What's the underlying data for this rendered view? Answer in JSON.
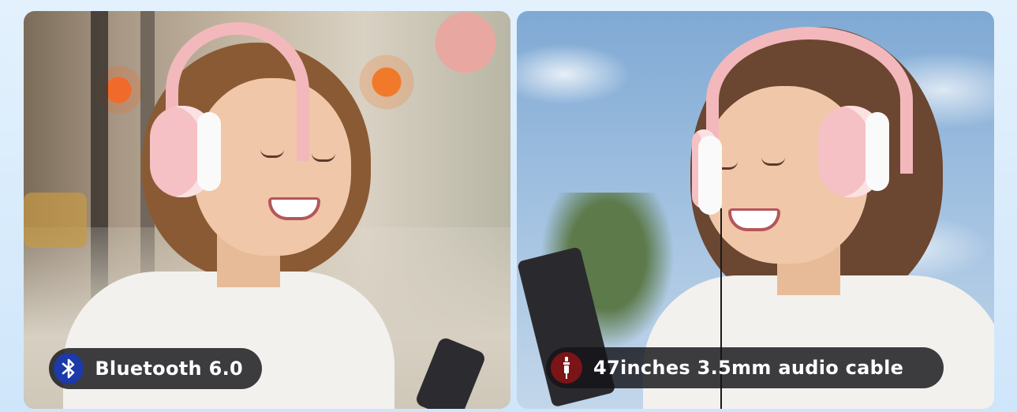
{
  "panels": [
    {
      "scene": "street",
      "badge": {
        "icon": "bluetooth-icon",
        "label": "Bluetooth 6.0",
        "icon_color": "#1c3aa8"
      }
    },
    {
      "scene": "sky",
      "badge": {
        "icon": "audio-jack-icon",
        "label": "47inches 3.5mm audio cable",
        "icon_color": "#7a1416"
      }
    }
  ],
  "colors": {
    "background": "#d9ecfb",
    "badge_bg": "#141418",
    "headphone_pink": "#f2b8bb",
    "badge_text": "#ffffff"
  }
}
